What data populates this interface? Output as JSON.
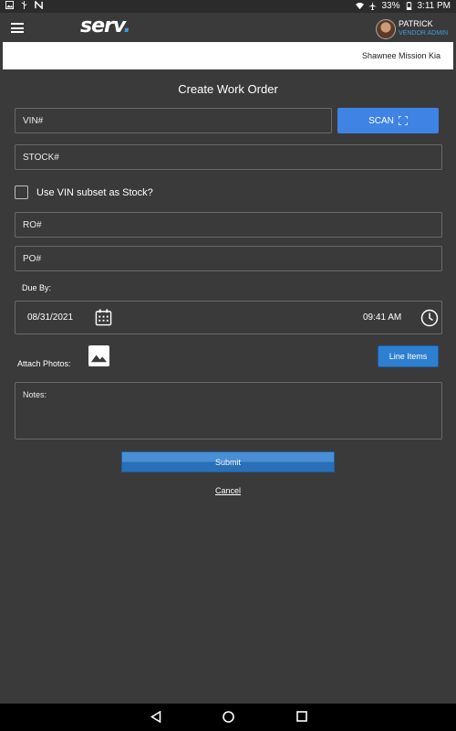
{
  "status_bar": {
    "battery": "33%",
    "time": "3:11 PM",
    "icons": [
      "image-icon",
      "usb-icon",
      "n-notification-icon",
      "wifi-icon",
      "airplane-icon",
      "battery-icon"
    ]
  },
  "header": {
    "logo_text": "serv",
    "logo_dot": ".",
    "user_name": "PATRICK",
    "user_role": "VENDOR ADMIN",
    "accent_color": "#3b9fe0"
  },
  "dealer": {
    "name": "Shawnee Mission Kia"
  },
  "form": {
    "title": "Create Work Order",
    "vin_placeholder": "VIN#",
    "scan_label": "SCAN",
    "stock_placeholder": "STOCK#",
    "use_vin_label": "Use VIN subset as Stock?",
    "ro_placeholder": "RO#",
    "po_placeholder": "PO#",
    "due_by_label": "Due By:",
    "due_date": "08/31/2021",
    "due_time": "09:41 AM",
    "attach_photos_label": "Attach Photos:",
    "line_items_label": "Line Items",
    "notes_placeholder": "Notes:",
    "submit_label": "Submit",
    "cancel_label": "Cancel"
  },
  "colors": {
    "background": "#3a3a3a",
    "primary_button": "#3f84e5"
  }
}
